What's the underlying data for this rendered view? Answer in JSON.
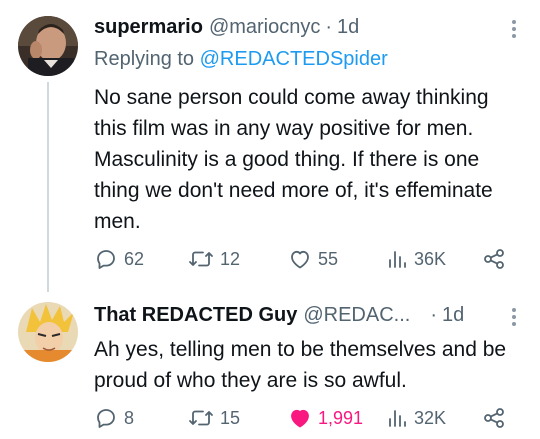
{
  "tweet1": {
    "name": "supermario",
    "handle": "@mariocnyc",
    "separator": "·",
    "time": "1d",
    "replying_prefix": "Replying to",
    "replying_handle": "@REDACTEDSpider",
    "text": "No sane person could come away thinking this film was in any way positive for men. Masculinity is a good thing. If there is one thing we don't need more of, it's effeminate men.",
    "replies": "62",
    "retweets": "12",
    "likes": "55",
    "views": "36K",
    "liked": false
  },
  "tweet2": {
    "name": "That REDACTED Guy",
    "handle": "@REDAC...",
    "separator": "·",
    "time": "1d",
    "text": "Ah yes, telling men to be themselves and be proud of who they are is so awful.",
    "replies": "8",
    "retweets": "15",
    "likes": "1,991",
    "views": "32K",
    "liked": true
  },
  "colors": {
    "text": "#0f1419",
    "muted": "#536471",
    "link": "#1d9bf0",
    "like_active": "#f91880",
    "thread_line": "#cfd9de"
  },
  "icons": [
    "reply-icon",
    "retweet-icon",
    "like-icon",
    "views-icon",
    "share-icon",
    "more-icon"
  ]
}
